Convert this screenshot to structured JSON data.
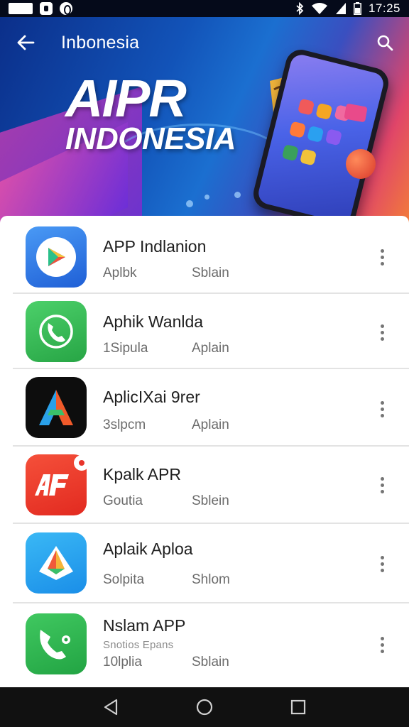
{
  "status_bar": {
    "time": "17:25",
    "left_icons": [
      "mail-icon",
      "app-notification-icon",
      "sync-icon"
    ],
    "right_icons": [
      "bluetooth-icon",
      "wifi-icon",
      "signal-icon",
      "battery-icon"
    ]
  },
  "header": {
    "title": "Inbonesia",
    "back_icon": "arrow-left-icon",
    "search_icon": "search-icon"
  },
  "hero": {
    "line1": "AIPR",
    "line2": "INDONESIA",
    "colors": {
      "start": "#0b2f8a",
      "mid": "#1b6fd0",
      "end": "#f27b3a"
    }
  },
  "apps": [
    {
      "name": "APP Indlanion",
      "meta_left": "Aplbk",
      "meta_right": "Sblain",
      "sub": "",
      "icon": "play-triangle-icon",
      "color": "#2f7be8",
      "badge": false
    },
    {
      "name": "Aphik Wanlda",
      "meta_left": "1Sipula",
      "meta_right": "Aplain",
      "sub": "",
      "icon": "phone-handset-icon",
      "color": "#34b553",
      "badge": false
    },
    {
      "name": "AplicIXai 9rer",
      "meta_left": "3slpcm",
      "meta_right": "Aplain",
      "sub": "",
      "icon": "a-logo-icon",
      "color": "#0d0d0d",
      "badge": false
    },
    {
      "name": "Kpalk APR",
      "meta_left": "Goutia",
      "meta_right": "Sblein",
      "sub": "",
      "icon": "af-logo-icon",
      "color": "#ee3a2a",
      "badge": true
    },
    {
      "name": "Aplaik Aploa",
      "meta_left": "Solpita",
      "meta_right": "Shlom",
      "sub": "",
      "icon": "diamond-shape-icon",
      "color": "#1aa3ef",
      "badge": false
    },
    {
      "name": "Nslam APP",
      "meta_left": "10lplia",
      "meta_right": "Sblain",
      "sub": "Snotios Epans",
      "icon": "phone-call-icon",
      "color": "#2fb04f",
      "badge": false
    }
  ],
  "nav": {
    "back_icon": "nav-back-icon",
    "home_icon": "nav-home-icon",
    "recent_icon": "nav-recent-icon"
  }
}
